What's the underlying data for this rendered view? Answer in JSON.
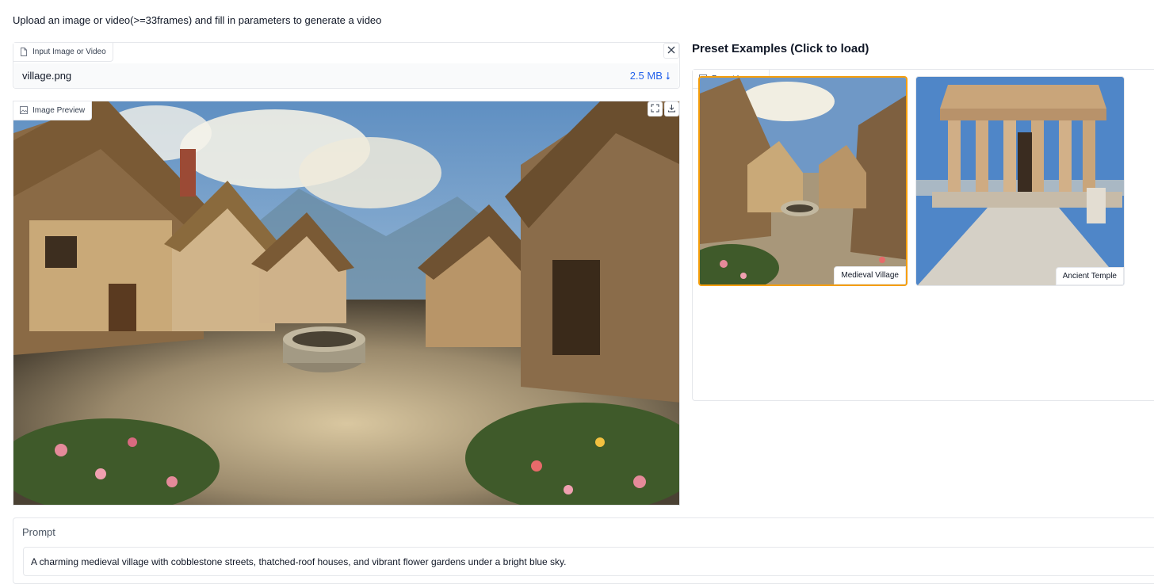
{
  "description": "Upload an image or video(>=33frames) and fill in parameters to generate a video",
  "input": {
    "label": "Input Image or Video",
    "file_name": "village.png",
    "file_size": "2.5 MB",
    "download_glyph": "⭣",
    "close_icon": "close-icon"
  },
  "preview": {
    "label": "Image Preview",
    "tools": [
      "fullscreen-icon",
      "download-icon"
    ]
  },
  "presets": {
    "title": "Preset Examples (Click to load)",
    "label": "Preset Images",
    "items": [
      {
        "caption": "Medieval Village",
        "selected": true
      },
      {
        "caption": "Ancient Temple",
        "selected": false
      }
    ]
  },
  "prompt": {
    "label": "Prompt",
    "value": "A charming medieval village with cobblestone streets, thatched-roof houses, and vibrant flower gardens under a bright blue sky."
  },
  "colors": {
    "accent": "#f59e0b",
    "link": "#2563eb",
    "border": "#e5e7eb"
  }
}
